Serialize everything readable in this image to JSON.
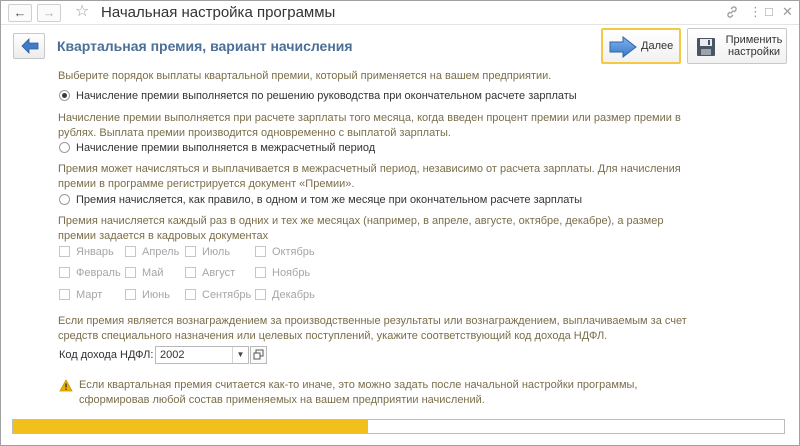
{
  "window": {
    "title": "Начальная настройка программы",
    "back_glyph": "←",
    "forward_glyph": "→",
    "star_glyph": "☆",
    "link_glyph": "🔗",
    "menu_glyph": "⋮",
    "maximize_glyph": "□",
    "close_glyph": "✕"
  },
  "header": {
    "title": "Квартальная премия,  вариант начисления",
    "next_label": "Далее",
    "apply_label": "Применить настройки"
  },
  "content": {
    "intro": "Выберите порядок выплаты квартальной премии, который применяется на вашем предприятии.",
    "options": [
      {
        "label": "Начисление премии выполняется по решению руководства при окончательном расчете зарплаты",
        "checked": true,
        "description_lines": [
          "Начисление премии выполняется при расчете зарплаты того месяца, когда введен процент премии или размер премии в",
          "рублях. Выплата премии производится одновременно с выплатой зарплаты."
        ]
      },
      {
        "label": "Начисление премии выполняется в межрасчетный период",
        "checked": false,
        "description_lines": [
          "Премия может начисляться и выплачивается в межрасчетный период, независимо от расчета зарплаты. Для начисления",
          "премии в программе регистрируется документ «Премии»."
        ]
      },
      {
        "label": "Премия начисляется, как правило, в одном и том же месяце при окончательном расчете зарплаты",
        "checked": false,
        "description_lines": [
          "Премия начисляется каждый раз в одних и тех же месяцах (например, в апреле, августе, октябре, декабре), а размер",
          "премии задается в кадровых документах"
        ]
      }
    ],
    "months": [
      [
        "Январь",
        "Апрель",
        "Июль",
        "Октябрь"
      ],
      [
        "Февраль",
        "Май",
        "Август",
        "Ноябрь"
      ],
      [
        "Март",
        "Июнь",
        "Сентябрь",
        "Декабрь"
      ]
    ],
    "ndfl_note_lines": [
      "Если премия является вознаграждением за производственные результаты или вознаграждением, выплачиваемым за счет",
      "средств специального назначения или целевых поступлений, укажите соответствующий код дохода НДФЛ."
    ],
    "ndfl_label": "Код дохода НДФЛ:",
    "ndfl_value": "2002",
    "ndfl_drop_glyph": "▼",
    "warning_lines": [
      "Если квартальная премия считается как-то иначе, это можно задать после начальной настройки программы,",
      "сформировав любой состав применяемых на вашем предприятии начислений."
    ]
  },
  "progress": {
    "fraction": 0.46
  },
  "colors": {
    "accent_title": "#4b6f96",
    "muted_text": "#7a6e4a",
    "progress_fill": "#f2c01b",
    "next_border": "#f4c842",
    "warning_icon": "#e9b200"
  }
}
